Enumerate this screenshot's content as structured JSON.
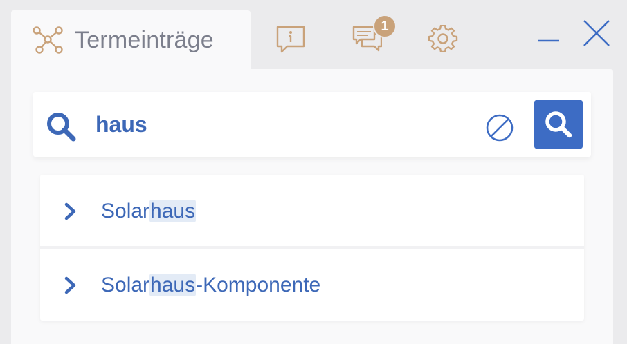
{
  "tabs": {
    "active": {
      "title": "Termeinträge",
      "icon": "network-icon"
    },
    "others": [
      {
        "name": "info-icon"
      },
      {
        "name": "comments-icon",
        "badge": "1"
      },
      {
        "name": "gear-icon"
      }
    ]
  },
  "window": {
    "minimize": "minimize-icon",
    "close": "close-icon"
  },
  "search": {
    "value": "haus",
    "icon": "search-icon",
    "clear": "clear-icon",
    "submit": "search-icon"
  },
  "results": [
    {
      "prefix": "Solar",
      "match": "haus",
      "suffix": ""
    },
    {
      "prefix": "Solar",
      "match": "haus",
      "suffix": "-Komponente"
    }
  ],
  "colors": {
    "accent": "#3d6cc4",
    "gold": "#c9a27a",
    "text_blue": "#3d68b7",
    "tab_text": "#7c7f8c"
  }
}
